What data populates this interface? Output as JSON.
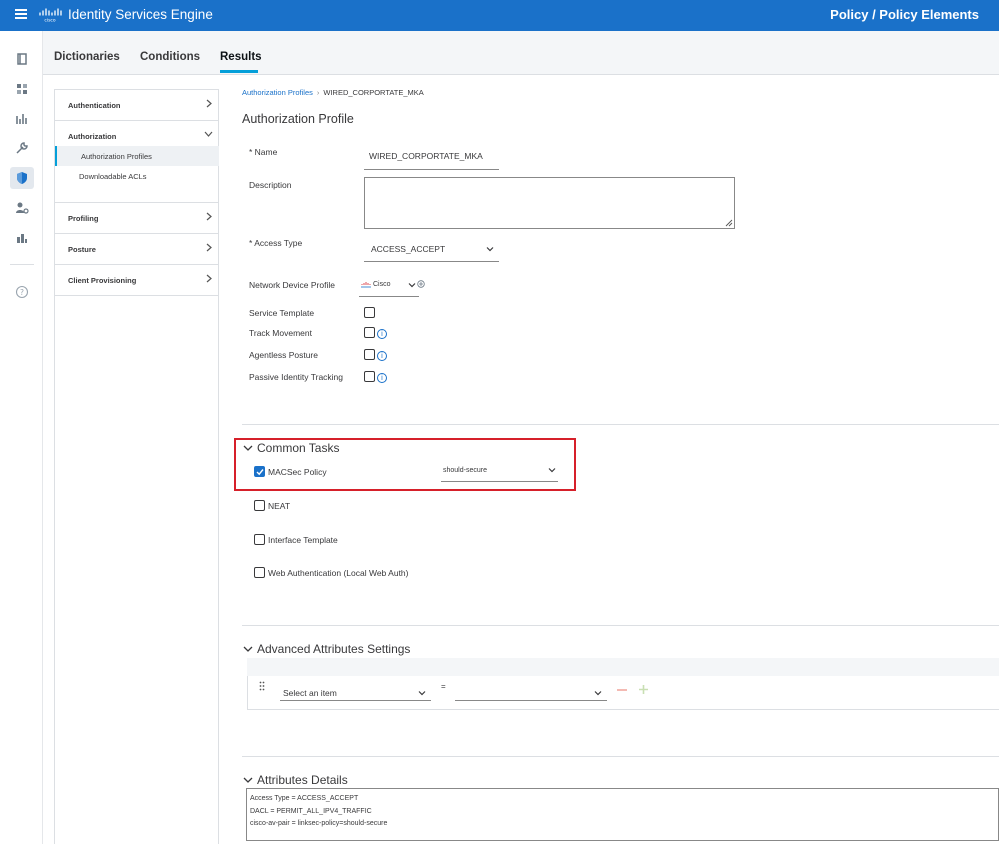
{
  "header": {
    "app_title": "Identity Services Engine",
    "page_path": "Policy / Policy Elements"
  },
  "tabs": [
    {
      "label": "Dictionaries"
    },
    {
      "label": "Conditions"
    },
    {
      "label": "Results"
    }
  ],
  "leftnav": {
    "sections": [
      {
        "label": "Authentication"
      },
      {
        "label": "Authorization"
      },
      {
        "label": "Profiling"
      },
      {
        "label": "Posture"
      },
      {
        "label": "Client Provisioning"
      }
    ],
    "authorization_items": [
      {
        "label": "Authorization Profiles"
      },
      {
        "label": "Downloadable ACLs"
      }
    ]
  },
  "breadcrumb": {
    "parent": "Authorization Profiles",
    "current": "WIRED_CORPORTATE_MKA"
  },
  "form": {
    "title": "Authorization Profile",
    "name_label": "* Name",
    "name_value": "WIRED_CORPORTATE_MKA",
    "description_label": "Description",
    "access_type_label": "* Access Type",
    "access_type_value": "ACCESS_ACCEPT",
    "ndp_label": "Network Device Profile",
    "ndp_value": "Cisco",
    "service_template_label": "Service Template",
    "track_movement_label": "Track Movement",
    "agentless_posture_label": "Agentless Posture",
    "passive_identity_label": "Passive Identity Tracking"
  },
  "common_tasks": {
    "title": "Common Tasks",
    "macsec_label": "MACSec Policy",
    "macsec_value": "should-secure",
    "neat_label": "NEAT",
    "interface_template_label": "Interface Template",
    "web_auth_label": "Web Authentication (Local Web Auth)"
  },
  "advanced": {
    "title": "Advanced Attributes Settings",
    "select_placeholder": "Select an item",
    "operator": "="
  },
  "details": {
    "title": "Attributes Details",
    "lines": [
      "Access Type = ACCESS_ACCEPT",
      "DACL = PERMIT_ALL_IPV4_TRAFFIC",
      "cisco-av-pair = linksec-policy=should-secure"
    ]
  },
  "colors": {
    "header_blue": "#1a71c9",
    "accent": "#049fd9",
    "highlight_red": "#d6202a"
  }
}
